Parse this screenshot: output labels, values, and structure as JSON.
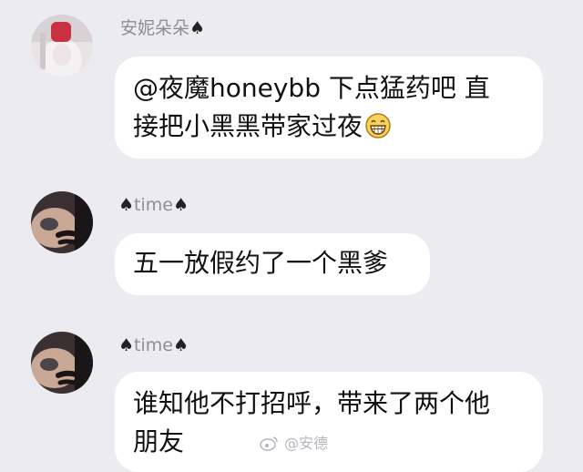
{
  "messages": [
    {
      "sender_name": "安妮朵朵",
      "sender_suffix": "♠",
      "lines": [
        "@夜魔honeybb 下点猛药吧  直",
        "接把小黑黑带家过夜"
      ],
      "emoji": "grinning-face-icon"
    },
    {
      "sender_prefix": "♠",
      "sender_name": "time",
      "sender_suffix": "♠",
      "lines": [
        "五一放假约了一个黑爹"
      ]
    },
    {
      "sender_prefix": "♠",
      "sender_name": "time",
      "sender_suffix": "♠",
      "lines": [
        "谁知他不打招呼，带来了两个他",
        "朋友"
      ]
    }
  ],
  "watermark": {
    "text": "@安德",
    "icon": "weibo-icon"
  },
  "colors": {
    "background": "#ebebf0",
    "bubble": "#ffffff",
    "sender_text": "#8e8e93"
  }
}
